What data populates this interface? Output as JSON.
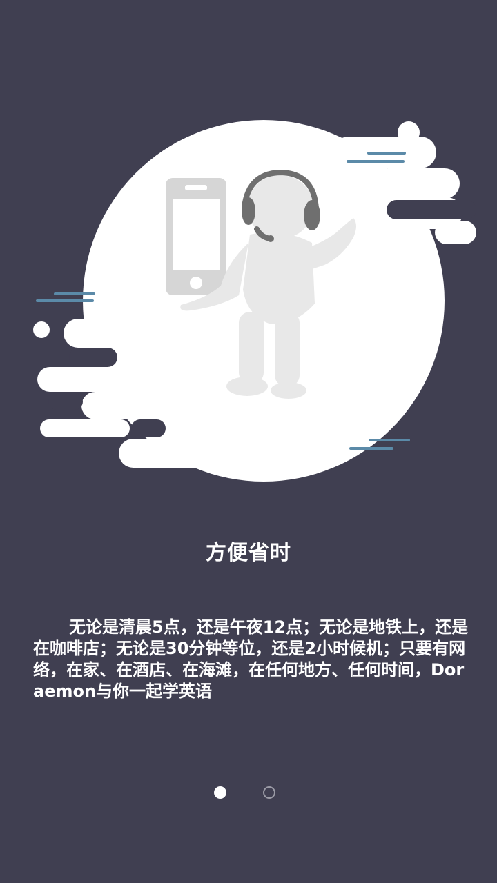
{
  "intro": {
    "title": "方便省时",
    "description": "无论是清晨5点，还是午夜12点；无论是地铁上，还是在咖啡店；无论是30分钟等位，还是2小时候机；只要有网络，在家、在酒店、在海滩，在任何地方、任何时间，Doraemon与你一起学英语"
  },
  "pager": {
    "total": 2,
    "current": 1
  },
  "colors": {
    "background": "#403f51",
    "blob": "#ffffff",
    "accent_lines": "#5b8aa8",
    "figure": "#e8e8e8",
    "phone": "#d6d6d6"
  },
  "icons": {
    "illustration": "customer-service-figure-with-phone"
  }
}
